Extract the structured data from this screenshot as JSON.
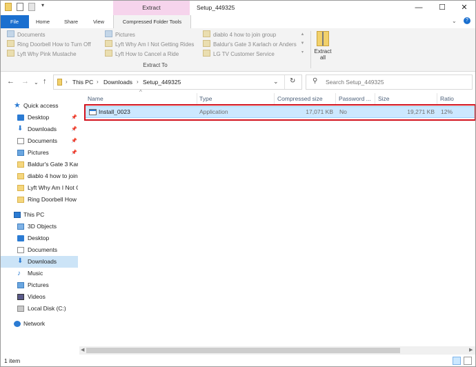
{
  "window": {
    "title": "Setup_449325",
    "minimize": "—",
    "maximize": "☐",
    "close": "✕"
  },
  "ribbon_tabs": {
    "context_group": "Extract",
    "file": "File",
    "home": "Home",
    "share": "Share",
    "view": "View",
    "compressed_tools": "Compressed Folder Tools"
  },
  "ribbon": {
    "destinations_col1": [
      "Documents",
      "Ring Doorbell How to Turn Off",
      "Lyft Why Pink Mustache"
    ],
    "destinations_col2": [
      "Pictures",
      "Lyft Why Am I Not Getting Rides",
      "Lyft How to Cancel a Ride"
    ],
    "destinations_col3": [
      "diablo 4 how to join group",
      "Baldur's Gate 3 Karlach or Anders",
      "LG TV Customer Service"
    ],
    "group_label": "Extract To",
    "extract_all_line1": "Extract",
    "extract_all_line2": "all"
  },
  "address": {
    "crumbs": [
      "This PC",
      "Downloads",
      "Setup_449325"
    ],
    "search_placeholder": "Search Setup_449325"
  },
  "nav": {
    "quick_access": "Quick access",
    "quick_items": [
      "Desktop",
      "Downloads",
      "Documents",
      "Pictures"
    ],
    "recent_folders": [
      "Baldur's Gate 3 Karlach",
      "diablo 4 how to join",
      "Lyft Why Am I Not G",
      "Ring Doorbell How"
    ],
    "this_pc": "This PC",
    "pc_items": [
      "3D Objects",
      "Desktop",
      "Documents",
      "Downloads",
      "Music",
      "Pictures",
      "Videos",
      "Local Disk (C:)"
    ],
    "network": "Network"
  },
  "columns": {
    "name": "Name",
    "type": "Type",
    "compressed_size": "Compressed size",
    "password": "Password ...",
    "size": "Size",
    "ratio": "Ratio"
  },
  "files": [
    {
      "name": "Install_0023",
      "type": "Application",
      "compressed_size": "17,071 KB",
      "password": "No",
      "size": "19,271 KB",
      "ratio": "12%"
    }
  ],
  "status": {
    "item_count": "1 item"
  }
}
